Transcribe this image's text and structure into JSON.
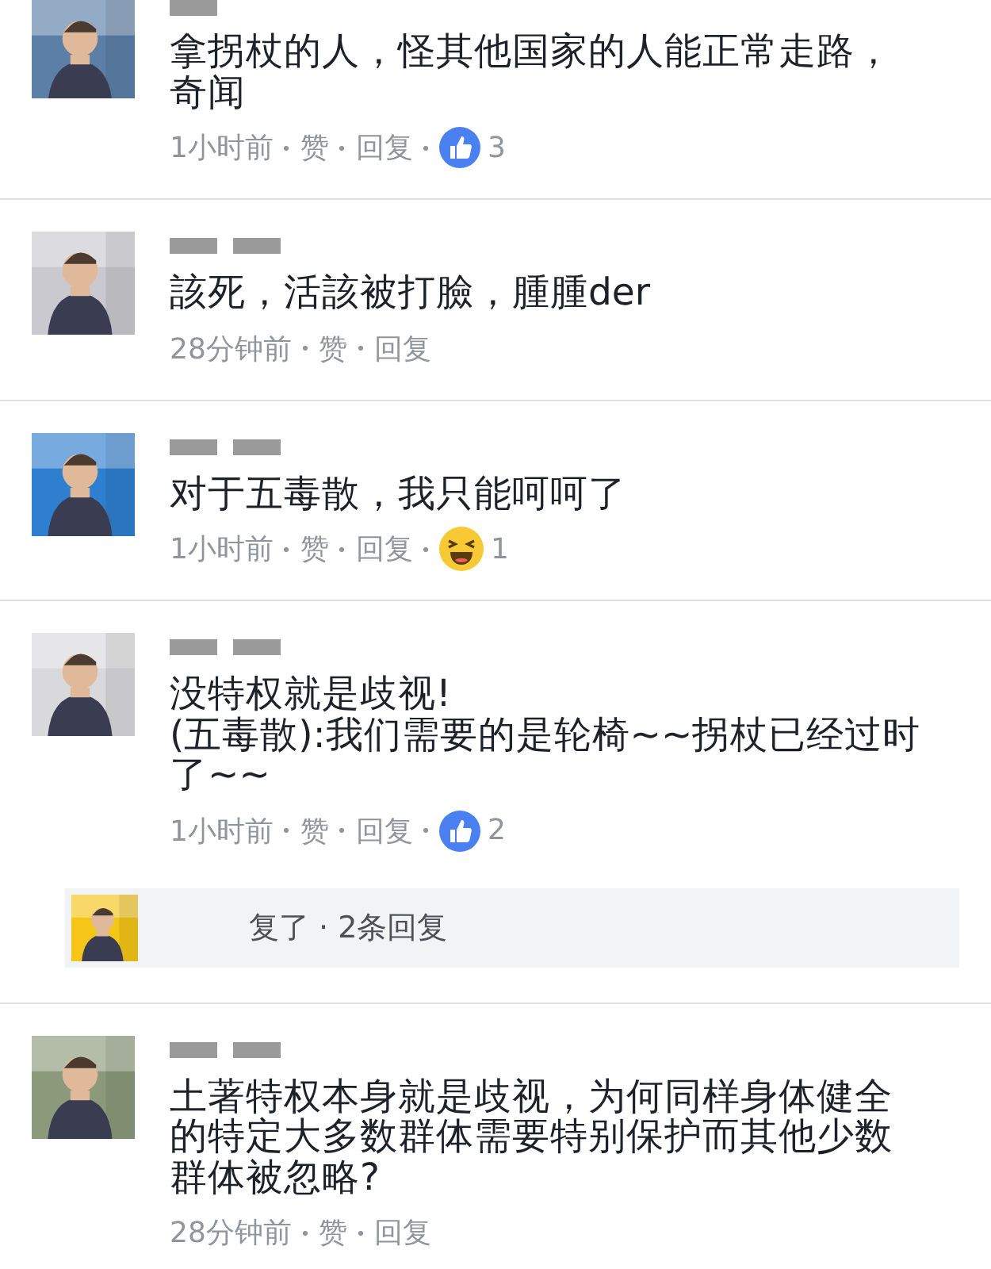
{
  "comments": [
    {
      "text": "拿拐杖的人，怪其他国家的人能正常走路，奇闻",
      "time": "1小时前",
      "actions": [
        "赞",
        "回复"
      ],
      "reaction": {
        "kind": "like",
        "count": "3"
      }
    },
    {
      "text": "該死，活該被打臉，腫腫der",
      "time": "28分钟前",
      "actions": [
        "赞",
        "回复"
      ]
    },
    {
      "text": "对于五毒散，我只能呵呵了",
      "time": "1小时前",
      "actions": [
        "赞",
        "回复"
      ],
      "reaction": {
        "kind": "haha",
        "count": "1"
      }
    },
    {
      "text": "没特权就是歧视!\n(五毒散):我们需要的是轮椅~~拐杖已经过时了~~",
      "time": "1小时前",
      "actions": [
        "赞",
        "回复"
      ],
      "reaction": {
        "kind": "like",
        "count": "2"
      },
      "reply_summary": {
        "text": "复了 · 2条回复"
      }
    },
    {
      "text": "土著特权本身就是歧视，为何同样身体健全的特定大多数群体需要特别保护而其他少数群体被忽略?",
      "time": "28分钟前",
      "actions": [
        "赞",
        "回复"
      ]
    }
  ]
}
